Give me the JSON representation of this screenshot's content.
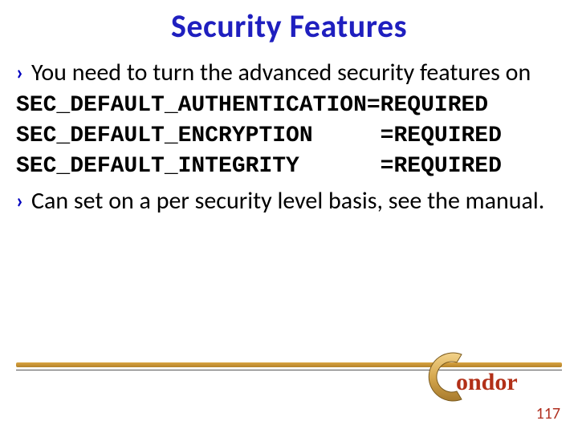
{
  "title": "Security Features",
  "bullets": {
    "b1": "You need to turn the advanced security features on",
    "b2": "Can set on a per security level basis, see the manual."
  },
  "config_lines": {
    "l1": "SEC_DEFAULT_AUTHENTICATION=REQUIRED",
    "l2": "SEC_DEFAULT_ENCRYPTION     =REQUIRED",
    "l3": "SEC_DEFAULT_INTEGRITY      =REQUIRED"
  },
  "page_number": "117",
  "logo_text": "ondor"
}
